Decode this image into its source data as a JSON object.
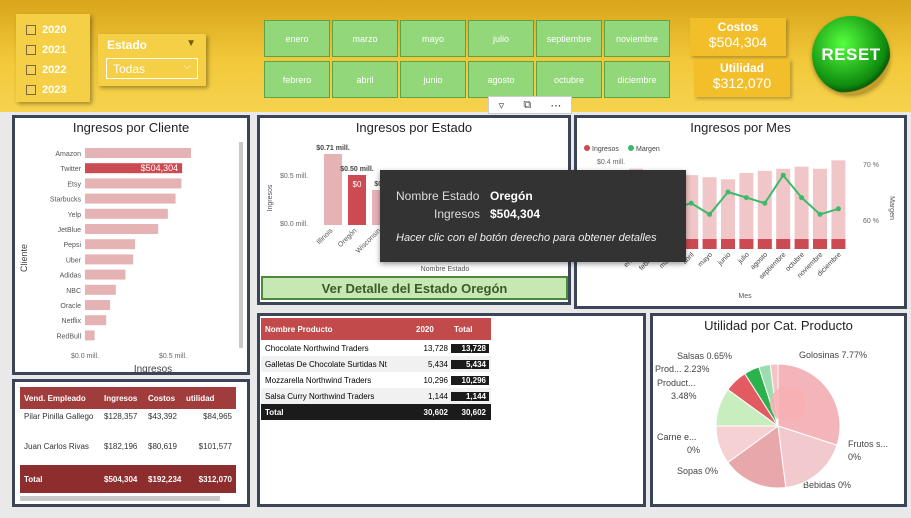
{
  "years": [
    "2020",
    "2021",
    "2022",
    "2023"
  ],
  "estado_filter": {
    "label": "Estado",
    "value": "Todas"
  },
  "months": [
    "enero",
    "marzo",
    "mayo",
    "julio",
    "septiembre",
    "noviembre",
    "febrero",
    "abril",
    "junio",
    "agosto",
    "octubre",
    "diciembre"
  ],
  "kpis": {
    "costos": {
      "label": "Costos",
      "value": "$504,304"
    },
    "utilidad": {
      "label": "Utilidad",
      "value": "$312,070"
    }
  },
  "reset_label": "RESET",
  "colors": {
    "bar": "#e6b3b5",
    "bar_highlight": "#cc4b52",
    "line": "#3cb96a",
    "panel_border": "#3c4458",
    "header": "#f2c93a",
    "month_btn": "#92d87a"
  },
  "cliente_chart": {
    "title": "Ingresos por Cliente",
    "ylabel": "Cliente",
    "xlabel": "Ingresos",
    "highlight_label": "$504,304",
    "ticks": [
      "$0.0 mill.",
      "$0.5 mill."
    ],
    "chart_data": {
      "type": "bar",
      "orientation": "horizontal",
      "categories": [
        "Amazon",
        "Twitter",
        "Etsy",
        "Starbucks",
        "Yelp",
        "JetBlue",
        "Pepsi",
        "Uber",
        "Adidas",
        "NBC",
        "Oracle",
        "Netflix",
        "RedBull"
      ],
      "values": [
        0.55,
        0.504,
        0.5,
        0.47,
        0.43,
        0.38,
        0.26,
        0.25,
        0.21,
        0.16,
        0.13,
        0.11,
        0.05
      ],
      "highlight_index": 1,
      "xlim": [
        0,
        0.55
      ]
    }
  },
  "estado_chart": {
    "title": "Ingresos por Estado",
    "ylabel": "Ingresos",
    "xlabel": "Nombre Estado",
    "ticks": [
      "$0.5 mill.",
      "$0.0 mill."
    ],
    "bar_labels": [
      "$0.71 mill.",
      "$0.50 mill.",
      "$0..."
    ],
    "highlight_short": "$0",
    "chart_data": {
      "type": "bar",
      "categories": [
        "Illinois",
        "Oregón",
        "Wisconsin",
        "..."
      ],
      "values": [
        0.71,
        0.5,
        0.35,
        0.2
      ],
      "highlight_index": 1,
      "ylim": [
        0,
        0.8
      ]
    }
  },
  "tooltip": {
    "k1": "Nombre Estado",
    "v1": "Oregón",
    "k2": "Ingresos",
    "v2": "$504,304",
    "hint": "Hacer clic con el botón derecho para obtener detalles"
  },
  "detail_button": "Ver Detalle del Estado Oregón",
  "mes_chart": {
    "title": "Ingresos por Mes",
    "legend": [
      "Ingresos",
      "Margen"
    ],
    "left_tick": "$0.4 mill.",
    "right_ticks": [
      "70 %",
      "60 %"
    ],
    "xlabel": "Mes",
    "ylabel_right": "Margen",
    "chart_data": {
      "type": "bar",
      "categories": [
        "enero",
        "febrero",
        "marzo",
        "abril",
        "mayo",
        "junio",
        "julio",
        "agosto",
        "septiembre",
        "octubre",
        "noviembre",
        "diciembre"
      ],
      "series": [
        {
          "name": "Ingresos",
          "values": [
            0.38,
            0.37,
            0.36,
            0.35,
            0.34,
            0.33,
            0.36,
            0.37,
            0.38,
            0.39,
            0.38,
            0.42
          ]
        },
        {
          "name": "Margen",
          "values": [
            66,
            64,
            62,
            63,
            61,
            65,
            64,
            63,
            68,
            64,
            61,
            62
          ]
        }
      ],
      "ylim": [
        0,
        0.45
      ]
    }
  },
  "productos": {
    "headers": [
      "Nombre Producto",
      "2020",
      "Total"
    ],
    "rows": [
      [
        "Chocolate Northwind Traders",
        "13,728",
        "13,728"
      ],
      [
        "Galletas De Chocolate Surtidas Nt",
        "5,434",
        "5,434"
      ],
      [
        "Mozzarella Northwind Traders",
        "10,296",
        "10,296"
      ],
      [
        "Salsa Curry Northwind Traders",
        "1,144",
        "1,144"
      ]
    ],
    "total": [
      "Total",
      "30,602",
      "30,602"
    ]
  },
  "vendedores": {
    "headers": [
      "Vend. Empleado",
      "Ingresos",
      "Costos",
      "utilidad"
    ],
    "rows": [
      [
        "Pilar Pinilla Gallego",
        "$128,357",
        "$43,392",
        "$84,965"
      ],
      [
        "Juan Carlos Rivas",
        "$182,196",
        "$80,619",
        "$101,577"
      ]
    ],
    "total": [
      "Total",
      "$504,304",
      "$192,234",
      "$312,070"
    ]
  },
  "pie_chart": {
    "title": "Utilidad por Cat. Producto",
    "labels": [
      "Golosinas 7.77%",
      "Frutos s...",
      "0%",
      "Bebidas 0%",
      "Sopas 0%",
      "Carne e...",
      "0%",
      "Product...",
      "3.48%",
      "Prod... 2.23%",
      "Salsas 0.65%"
    ],
    "chart_data": {
      "type": "pie",
      "categories": [
        "Golosinas",
        "Frutos secos",
        "Bebidas",
        "Sopas",
        "Carne",
        "Productos",
        "Prod",
        "Salsas"
      ],
      "values": [
        7.77,
        0,
        0,
        0,
        0,
        3.48,
        2.23,
        0.65
      ]
    }
  }
}
